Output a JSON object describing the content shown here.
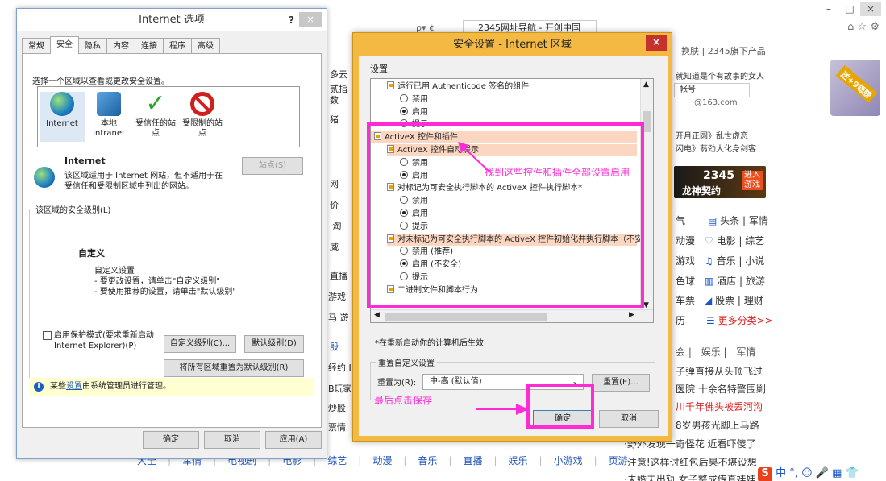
{
  "browser": {
    "tab_title": "2345网址导航 - 开创中国",
    "window_controls": [
      "–",
      "□",
      "×"
    ],
    "header_links": [
      "换肤",
      "2345旗下产品"
    ],
    "ad_text": "就知道是个有故事的女人",
    "login": {
      "account_label": "帐号",
      "domain": "@163.com"
    },
    "news_lines": [
      "开月正圆》乱世虚恋",
      "闪电》蓊劲大化身剑客"
    ],
    "game_banner": {
      "title": "2345",
      "subtitle": "龙神契约",
      "cta": "进入游戏"
    },
    "promo_badge": "送+9翅膀",
    "left_fragments": [
      "多云",
      "贰指数",
      "猪",
      "网",
      "价",
      "·淘",
      "威",
      "直播",
      "游戏",
      "马 遊",
      "殷",
      "经约 I",
      "B玩家",
      "炒股",
      "票情"
    ],
    "category_links": [
      [
        "气",
        "头条",
        "军情"
      ],
      [
        "动漫",
        "电影",
        "综艺"
      ],
      [
        "游戏",
        "音乐",
        "小说"
      ],
      [
        "色球",
        "酒店",
        "旅游"
      ],
      [
        "车票",
        "股票",
        "理财"
      ],
      [
        "历",
        "更多分类>>"
      ]
    ],
    "news_tabs": [
      "会",
      "娱乐",
      "军情"
    ],
    "news_items": [
      "子弹直接从头顶飞过",
      "医院 十余名特警围剿",
      "川千年佛头被丢河沟",
      "8岁男孩光脚上马路"
    ],
    "footer_news": [
      "·野外发现一奇怪花 近看吓傻了",
      "·注意!这样讨红包后果不堪设想",
      "·未婚夫出轨 女子整成传真娃娃"
    ],
    "bottom_nav": [
      "大全",
      "军情",
      "电视剧",
      "电影",
      "综艺",
      "动漫",
      "音乐",
      "直播",
      "娱乐",
      "小游戏",
      "页游"
    ],
    "taskbar_tray": [
      "中",
      "°,",
      "☺",
      "🎤",
      "▦",
      "👕"
    ]
  },
  "internet_options": {
    "title": "Internet 选项",
    "help": "?",
    "close": "×",
    "tabs": [
      "常规",
      "安全",
      "隐私",
      "内容",
      "连接",
      "程序",
      "高级"
    ],
    "active_tab": "安全",
    "select_zone_label": "选择一个区域以查看或更改安全设置。",
    "zones": [
      {
        "name": "Internet",
        "icon": "globe-icon"
      },
      {
        "name": "本地 Intranet",
        "icon": "intranet-icon"
      },
      {
        "name": "受信任的站点",
        "icon": "check-icon"
      },
      {
        "name": "受限制的站点",
        "icon": "restricted-icon"
      }
    ],
    "zone_heading": "Internet",
    "zone_description": "该区域适用于 Internet 网站，但不适用于在受信任和受限制区域中列出的网站。",
    "sites_button": "站点(S)",
    "security_level_label": "该区域的安全级别(L)",
    "custom_title": "自定义",
    "custom_lines": [
      "自定义设置",
      "- 要更改设置，请单击\"自定义级别\"",
      "- 要使用推荐的设置，请单击\"默认级别\""
    ],
    "protected_mode": "启用保护模式(要求重新启动 Internet Explorer)(P)",
    "custom_level_button": "自定义级别(C)...",
    "default_level_button": "默认级别(D)",
    "reset_all_button": "将所有区域重置为默认级别(R)",
    "info_prefix": "某些",
    "info_link": "设置",
    "info_suffix": "由系统管理员进行管理。",
    "ok": "确定",
    "cancel": "取消",
    "apply": "应用(A)"
  },
  "security_settings": {
    "title": "安全设置 - Internet 区域",
    "close": "×",
    "settings_label": "设置",
    "items": [
      {
        "text": "运行已用 Authenticode 签名的组件",
        "kind": "header"
      },
      {
        "text": "禁用",
        "kind": "radio",
        "on": false
      },
      {
        "text": "启用",
        "kind": "radio",
        "on": true
      },
      {
        "text": "提示",
        "kind": "radio",
        "on": false
      },
      {
        "text": "ActiveX 控件和插件",
        "kind": "group"
      },
      {
        "text": "ActiveX 控件自动提示",
        "kind": "header"
      },
      {
        "text": "禁用",
        "kind": "radio",
        "on": false
      },
      {
        "text": "启用",
        "kind": "radio",
        "on": true
      },
      {
        "text": "对标记为可安全执行脚本的 ActiveX 控件执行脚本*",
        "kind": "header"
      },
      {
        "text": "禁用",
        "kind": "radio",
        "on": false
      },
      {
        "text": "启用",
        "kind": "radio",
        "on": true
      },
      {
        "text": "提示",
        "kind": "radio",
        "on": false
      },
      {
        "text": "对未标记为可安全执行脚本的 ActiveX 控件初始化并执行脚本（不安",
        "kind": "header"
      },
      {
        "text": "禁用 (推荐)",
        "kind": "radio",
        "on": false
      },
      {
        "text": "启用 (不安全)",
        "kind": "radio",
        "on": true
      },
      {
        "text": "提示",
        "kind": "radio",
        "on": false
      },
      {
        "text": "二进制文件和脚本行为",
        "kind": "header"
      }
    ],
    "restart_note": "*在重新启动你的计算机后生效",
    "reset_group_label": "重置自定义设置",
    "reset_to_label": "重置为(R):",
    "reset_value": "中-高 (默认值)",
    "reset_button": "重置(E)...",
    "ok": "确定",
    "cancel": "取消"
  },
  "annotations": {
    "enable_all": "找到这些控件和插件全部设置启用",
    "save": "最后点击保存",
    "color": "#ff2bd7"
  }
}
